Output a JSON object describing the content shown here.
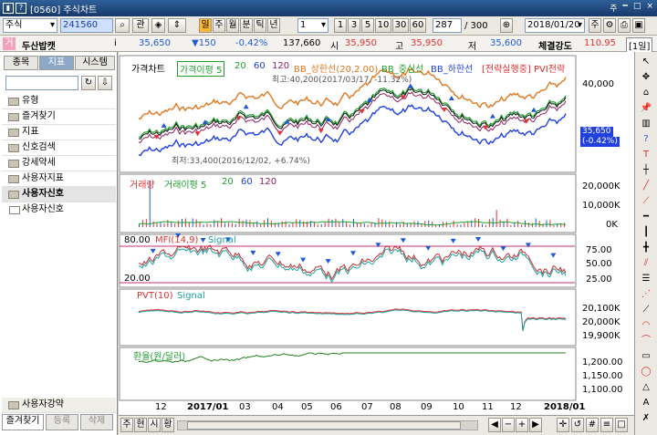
{
  "window": {
    "title": "[0560] 주식차트",
    "controls": [
      "주",
      "━",
      "□",
      "×"
    ]
  },
  "toolbar1": {
    "market": "주식",
    "code": "241560",
    "quick1": "관",
    "period_buttons": [
      "일",
      "주",
      "월",
      "분",
      "틱",
      "년"
    ],
    "count_select": "1",
    "interval_buttons": [
      "1",
      "3",
      "5",
      "10",
      "30",
      "60"
    ],
    "view_count": "287",
    "total_count": "/ 300",
    "date": "2018/01/20",
    "options": [
      "주"
    ]
  },
  "toolbar2": {
    "badge": "거",
    "stock_name": "두산밥캣",
    "price": "35,650",
    "change": "▼150",
    "change_pct": "-0.42%",
    "volume": "137,660",
    "open_label": "시",
    "open": "35,950",
    "high_label": "고",
    "high": "35,950",
    "low_label": "저",
    "low": "35,600",
    "strength_label": "체결강도",
    "strength": "110.95",
    "period_tag": "[1일]"
  },
  "left_panel": {
    "tabs": [
      "종목",
      "지표",
      "시스템"
    ],
    "tree": [
      "유형",
      "즐겨찾기",
      "지표",
      "신호검색",
      "강세약세",
      "사용자지표",
      "사용자신호"
    ],
    "sub_item": "사용자신호",
    "bottom_items": [
      "사용자강약"
    ],
    "bottom_tabs": [
      "즐겨찾기",
      "등록",
      "삭제"
    ]
  },
  "price_panel": {
    "title": "가격차트",
    "legend": [
      "가격이평 5",
      "20",
      "60",
      "120",
      "BB_상한선(20,2.00)",
      "BB_중심선",
      "BB_하한선",
      "[전략실행중] PVI전략"
    ],
    "max_note": "최고:40,200(2017/03/17, -11.32%)",
    "min_note": "최저:33,400(2016/12/02, +6.74%)",
    "y_labels": [
      "40,000"
    ],
    "current_price": "35,650",
    "current_pct": "(-0.42%)"
  },
  "volume_panel": {
    "legend": [
      "거래량",
      "거래이평 5",
      "20",
      "60",
      "120"
    ],
    "y_labels": [
      "20,000K",
      "10,000K",
      "0K"
    ]
  },
  "mfi_panel": {
    "legend": [
      "MFI(14,9)",
      "Signal"
    ],
    "top_val": "80.00",
    "bottom_val": "20.00",
    "y_labels": [
      "75.00",
      "50.00",
      "25.00"
    ]
  },
  "pvt_panel": {
    "legend": [
      "PVT(10)",
      "Signal"
    ],
    "y_labels": [
      "20,100K",
      "20,000K",
      "19,900K"
    ]
  },
  "fx_panel": {
    "legend": [
      "환율(원/달러)"
    ],
    "y_labels": [
      "1,200.00",
      "1,150.00",
      "1,100.00"
    ]
  },
  "x_axis": [
    "12",
    "2017/01",
    "03",
    "04",
    "05",
    "06",
    "07",
    "08",
    "09",
    "10",
    "11",
    "12",
    "2018/01"
  ],
  "bottom_bar": [
    "주",
    "현",
    "시",
    "황"
  ],
  "colors": {
    "up": "#e03030",
    "down": "#1e5ad8",
    "orange": "#e07820",
    "green": "#20a030",
    "blue": "#2040e0",
    "accent": "#ffd200"
  }
}
